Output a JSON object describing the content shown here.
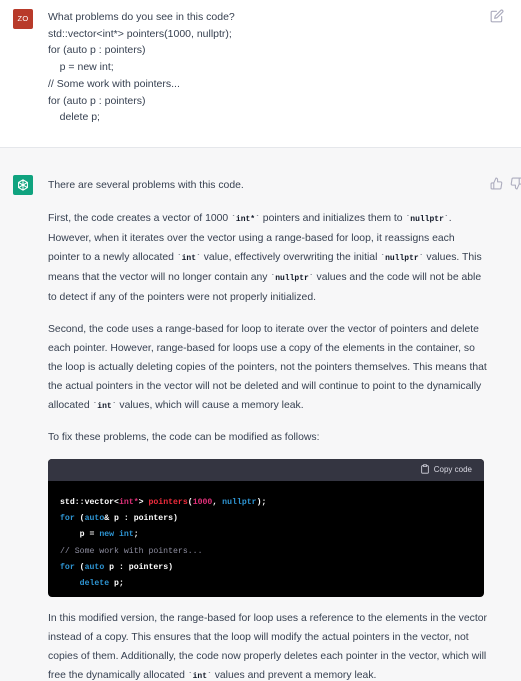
{
  "user": {
    "avatar": "ZO",
    "lines": [
      "What problems do you see in this code?",
      "std::vector<int*> pointers(1000, nullptr);",
      "for (auto p : pointers)",
      "    p = new int;",
      "// Some work with pointers...",
      "for (auto p : pointers)",
      "    delete p;"
    ],
    "edit_icon": "edit-icon"
  },
  "assistant": {
    "intro": "There are several problems with this code.",
    "p1": {
      "a": "First, the code creates a vector of 1000 ",
      "c1": "int*",
      "b": " pointers and initializes them to ",
      "c2": "nullptr",
      "c": ". However, when it iterates over the vector using a range-based for loop, it reassigns each pointer to a newly allocated ",
      "c3": "int",
      "d": " value, effectively overwriting the initial ",
      "c4": "nullptr",
      "e": " values. This means that the vector will no longer contain any ",
      "c5": "nullptr",
      "f": " values and the code will not be able to detect if any of the pointers were not properly initialized."
    },
    "p2": {
      "a": "Second, the code uses a range-based for loop to iterate over the vector of pointers and delete each pointer. However, range-based for loops use a copy of the elements in the container, so the loop is actually deleting copies of the pointers, not the pointers themselves. This means that the actual pointers in the vector will not be deleted and will continue to point to the dynamically allocated ",
      "c1": "int",
      "b": " values, which will cause a memory leak."
    },
    "fix_intro": "To fix these problems, the code can be modified as follows:",
    "copy_label": "Copy code",
    "code": {
      "l1": {
        "a": "std::vector<",
        "type": "int*",
        "b": "> ",
        "fn": "pointers",
        "c": "(",
        "num": "1000",
        "d": ", ",
        "null": "nullptr",
        "e": ");"
      },
      "l2": {
        "kw1": "for",
        "a": " (",
        "kw2": "auto",
        "b": "& p : pointers)"
      },
      "l3": {
        "a": "    p = ",
        "kw1": "new",
        "b": " ",
        "kw2": "int",
        "c": ";"
      },
      "l4": "// Some work with pointers...",
      "l5": {
        "kw1": "for",
        "a": " (",
        "kw2": "auto",
        "b": " p : pointers)"
      },
      "l6": {
        "a": "    ",
        "kw1": "delete",
        "b": " p;"
      }
    },
    "p3": {
      "a": "In this modified version, the range-based for loop uses a reference to the elements in the vector instead of a copy. This ensures that the loop will modify the actual pointers in the vector, not copies of them. Additionally, the code now properly deletes each pointer in the vector, which will free the dynamically allocated ",
      "c1": "int",
      "b": " values and prevent a memory leak."
    }
  },
  "icons": [
    "edit-icon",
    "openai-logo-icon",
    "thumbs-up-icon",
    "thumbs-down-icon",
    "clipboard-icon"
  ],
  "colors": {
    "user_avatar": "#b83a2a",
    "assistant_avatar": "#10a37f",
    "assistant_bg": "#f7f7f8",
    "code_bg": "#000000",
    "code_header": "#343541"
  }
}
